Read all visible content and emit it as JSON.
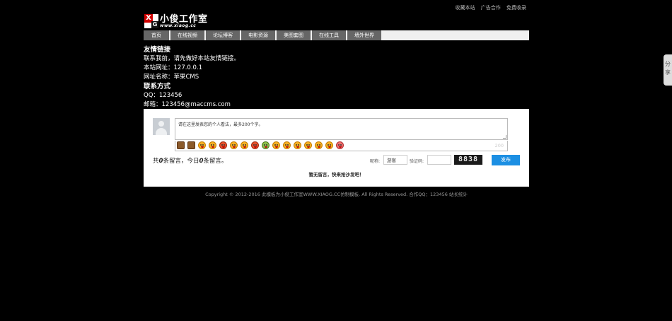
{
  "top_links": [
    "收藏本站",
    "广告合作",
    "免费收录"
  ],
  "logo": {
    "title": "小俊工作室",
    "url": "www.xiaog.cc",
    "mark_x": "X",
    "mark_g": "G"
  },
  "nav": [
    "首页",
    "在线视频",
    "论坛博客",
    "电影资源",
    "美图套图",
    "在线工具",
    "墙外世界"
  ],
  "friend_links": {
    "heading": "友情链接",
    "lines": [
      "联系我前，请先做好本站友情链接。",
      "本站网址：127.0.0.1",
      "网址名称：苹果CMS"
    ]
  },
  "contact": {
    "heading": "联系方式",
    "qq": "QQ：123456",
    "email": "邮箱：123456@maccms.com"
  },
  "comment": {
    "placeholder": "请在这里发表您的个人看法，最多200个字。",
    "char_limit": "200",
    "count_prefix": "共",
    "count_total": "0",
    "count_mid": "条留言，今日",
    "count_today": "0",
    "count_suffix": "条留言。",
    "nickname_label": "昵称:",
    "nickname_value": "游客",
    "code_label": "验证码:",
    "captcha": "8838",
    "submit": "发布",
    "empty": "暂无留言，快来抢沙发吧！"
  },
  "footer": "Copyright © 2012-2016 此模板为小俊工作室WWW.XIAOG.CC仿制模板. All Rights Reserved.   合作QQ：123456  站长统计",
  "share": {
    "line1": "分",
    "line2": "享"
  },
  "emoji_icons": [
    "heart-icon",
    "hat-icon",
    "face-icon",
    "face-icon",
    "face-icon",
    "face-icon",
    "face-icon",
    "face-icon",
    "face-icon",
    "face-icon",
    "face-icon",
    "face-icon",
    "face-icon",
    "face-icon",
    "face-icon",
    "face-icon"
  ]
}
